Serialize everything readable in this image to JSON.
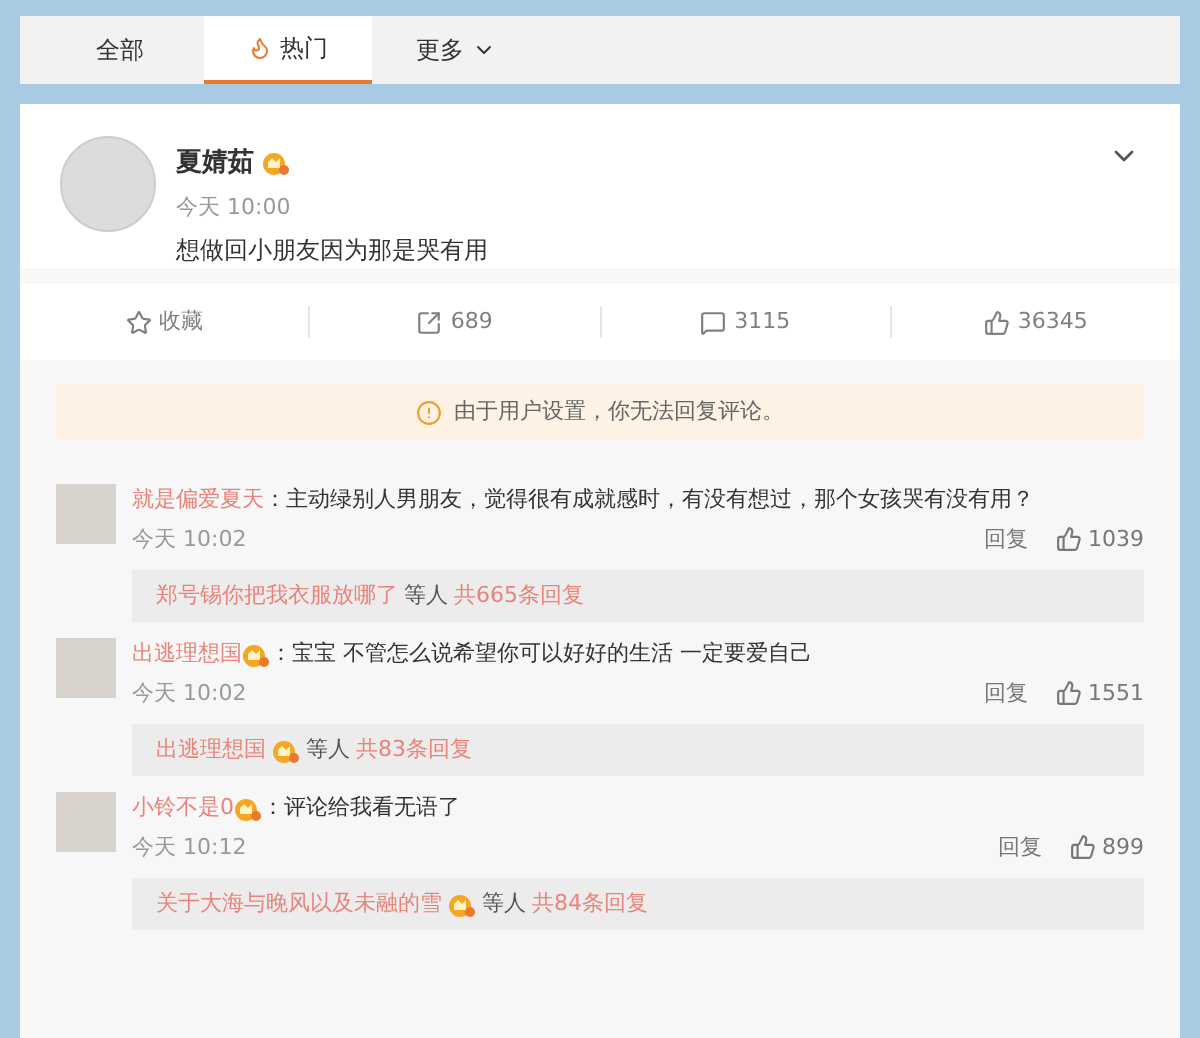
{
  "tabs": [
    {
      "label": "全部",
      "selected": false,
      "kind": "plain"
    },
    {
      "label": "热门",
      "selected": true,
      "kind": "flame"
    },
    {
      "label": "更多",
      "selected": false,
      "kind": "dropdown"
    }
  ],
  "post": {
    "author": "夏婧茹",
    "badge": true,
    "time": "今天 10:00",
    "text": "想做回小朋友因为那是哭有用",
    "actions": [
      {
        "kind": "star",
        "label": "收藏"
      },
      {
        "kind": "share",
        "label": "689"
      },
      {
        "kind": "comment",
        "label": "3115"
      },
      {
        "kind": "like",
        "label": "36345"
      }
    ]
  },
  "notice": "由于用户设置，你无法回复评论。",
  "comments": [
    {
      "name": "就是偏爱夏天",
      "badge": false,
      "text": "：主动绿别人男朋友，觉得很有成就感时，有没有想过，那个女孩哭有没有用？",
      "time": "今天 10:02",
      "reply": "回复",
      "likes": "1039",
      "thread": {
        "name": "郑号锡你把我衣服放哪了",
        "badge": false,
        "suffix": "等人",
        "count": "共665条回复"
      }
    },
    {
      "name": "出逃理想国",
      "badge": true,
      "text": "：宝宝 不管怎么说希望你可以好好的生活 一定要爱自己",
      "time": "今天 10:02",
      "reply": "回复",
      "likes": "1551",
      "thread": {
        "name": "出逃理想国",
        "badge": true,
        "suffix": "等人",
        "count": "共83条回复"
      }
    },
    {
      "name": "小铃不是0",
      "badge": true,
      "text": "：评论给我看无语了",
      "time": "今天 10:12",
      "reply": "回复",
      "likes": "899",
      "thread": {
        "name": "关于大海与晚风以及未融的雪",
        "badge": true,
        "suffix": "等人",
        "count": "共84条回复"
      }
    }
  ]
}
